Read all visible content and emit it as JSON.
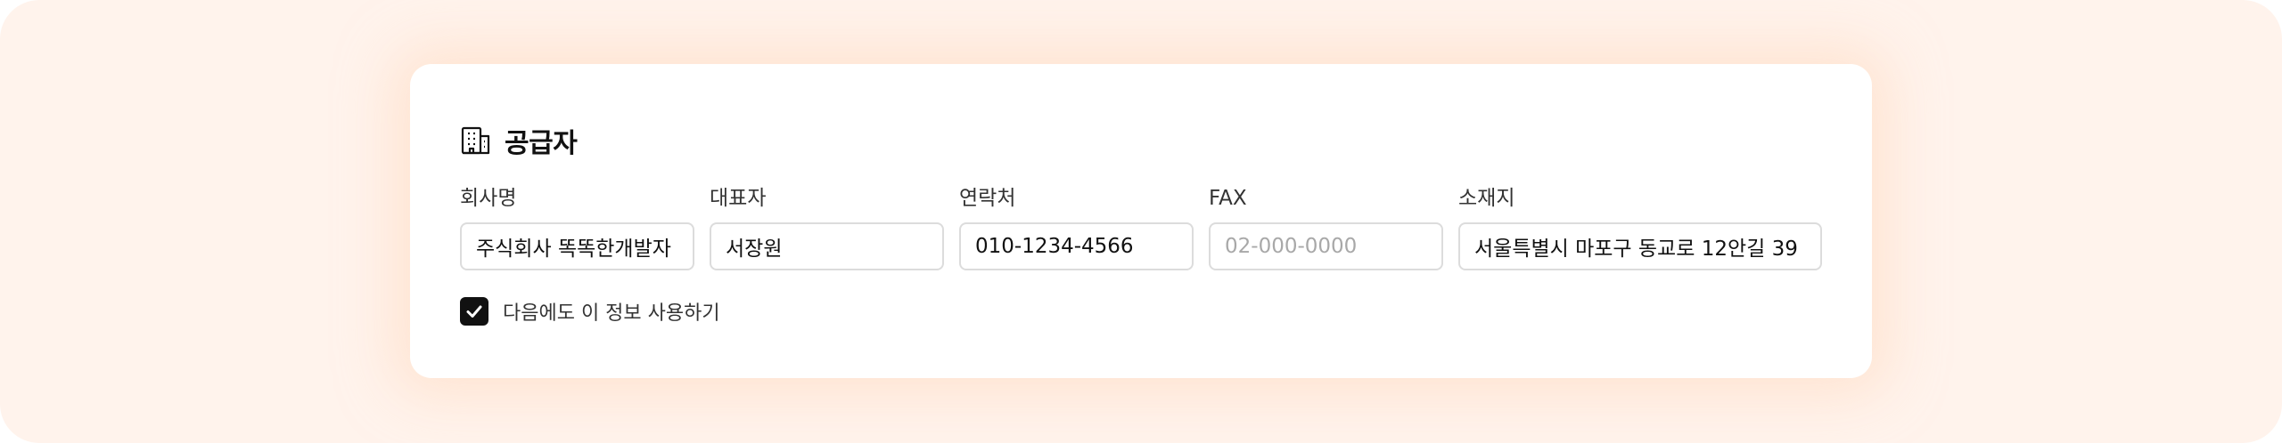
{
  "supplier": {
    "title": "공급자",
    "icon": "building-icon",
    "fields": {
      "company": {
        "label": "회사명",
        "value": "주식회사 똑똑한개발자"
      },
      "representative": {
        "label": "대표자",
        "value": "서장원"
      },
      "contact": {
        "label": "연락처",
        "value": "010-1234-4566"
      },
      "fax": {
        "label": "FAX",
        "value": "",
        "placeholder": "02-000-0000"
      },
      "address": {
        "label": "소재지",
        "value": "서울특별시 마포구 동교로 12안길 39"
      }
    },
    "remember": {
      "label": "다음에도 이 정보 사용하기",
      "checked": true
    }
  },
  "colors": {
    "backdrop": "#fff3ec",
    "card": "#ffffff",
    "checkbox": "#111111"
  }
}
